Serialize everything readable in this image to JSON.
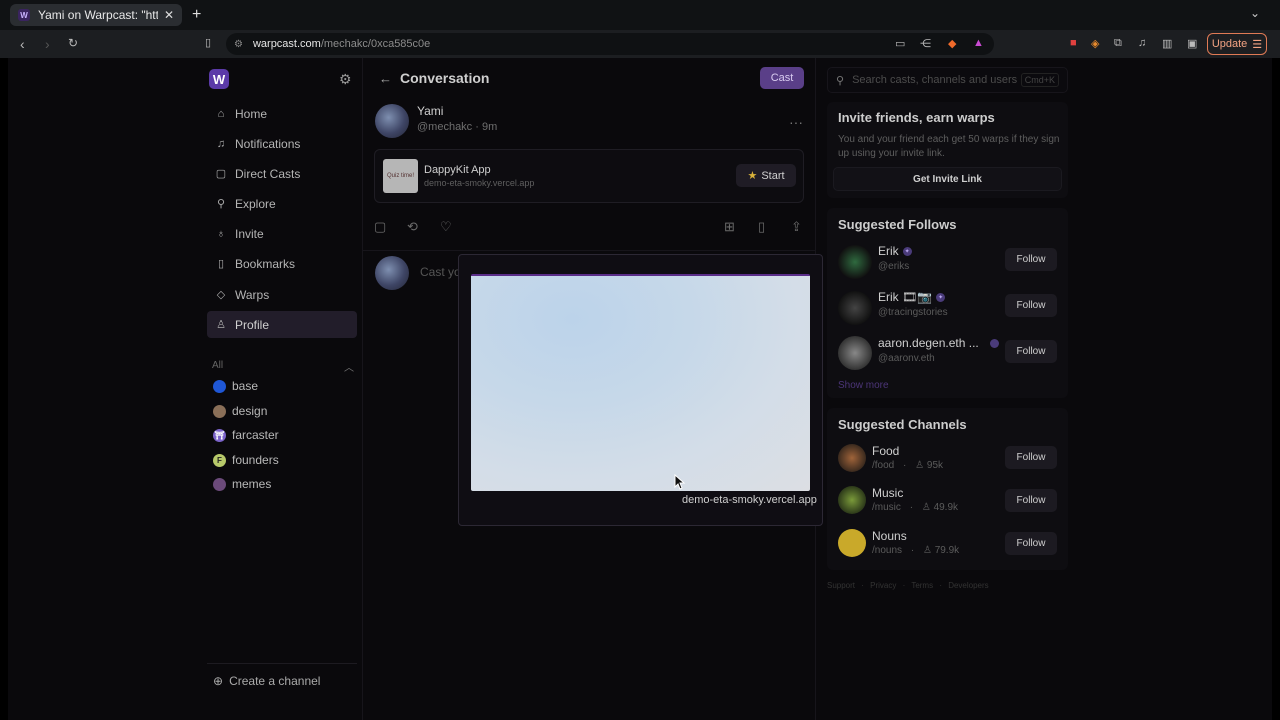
{
  "browser": {
    "tab_title": "Yami on Warpcast: \"https:",
    "url_host": "warpcast.com",
    "url_path": "/mechakc/0xca585c0e",
    "update_label": "Update"
  },
  "nav": {
    "items": [
      {
        "label": "Home",
        "icon": "home-icon"
      },
      {
        "label": "Notifications",
        "icon": "bell-icon"
      },
      {
        "label": "Direct Casts",
        "icon": "chat-icon"
      },
      {
        "label": "Explore",
        "icon": "search-icon"
      },
      {
        "label": "Invite",
        "icon": "users-icon"
      },
      {
        "label": "Bookmarks",
        "icon": "bookmark-icon"
      },
      {
        "label": "Warps",
        "icon": "diamond-icon"
      },
      {
        "label": "Profile",
        "icon": "user-icon"
      }
    ],
    "channels_header": "All",
    "channels": [
      {
        "label": "base",
        "color": "#1f57d6"
      },
      {
        "label": "design",
        "color": "#8a6f58"
      },
      {
        "label": "farcaster",
        "color": "#7b63c9"
      },
      {
        "label": "founders",
        "color": "#b7c96a"
      },
      {
        "label": "memes",
        "color": "#6b4a7a"
      }
    ],
    "create_channel": "Create a channel"
  },
  "conversation": {
    "title": "Conversation",
    "cast_button": "Cast",
    "author_name": "Yami",
    "author_meta": "@mechakc · 9m",
    "frame": {
      "thumb_text": "Quiz time!",
      "title": "DappyKit App",
      "url": "demo-eta-smoky.vercel.app",
      "button": "Start"
    },
    "reply_placeholder": "Cast yo"
  },
  "modal": {
    "url": "demo-eta-smoky.vercel.app"
  },
  "right": {
    "search_placeholder": "Search casts, channels and users",
    "search_shortcut": "Cmd+K",
    "invite_title": "Invite friends, earn warps",
    "invite_text": "You and your friend each get 50 warps if they sign up using your invite link.",
    "invite_button": "Get Invite Link",
    "follows_title": "Suggested Follows",
    "follows": [
      {
        "name": "Erik",
        "handle": "@eriks",
        "button": "Follow"
      },
      {
        "name": "Erik 🎞📷",
        "handle": "@tracingstories",
        "button": "Follow"
      },
      {
        "name": "aaron.degen.eth ...",
        "handle": "@aaronv.eth",
        "button": "Follow"
      }
    ],
    "show_more": "Show more",
    "channels_title": "Suggested Channels",
    "channels": [
      {
        "name": "Food",
        "handle": "/food",
        "count": "95k",
        "button": "Follow"
      },
      {
        "name": "Music",
        "handle": "/music",
        "count": "49.9k",
        "button": "Follow"
      },
      {
        "name": "Nouns",
        "handle": "/nouns",
        "count": "79.9k",
        "button": "Follow"
      }
    ],
    "footer": "Support · Privacy · Terms · Developers"
  }
}
